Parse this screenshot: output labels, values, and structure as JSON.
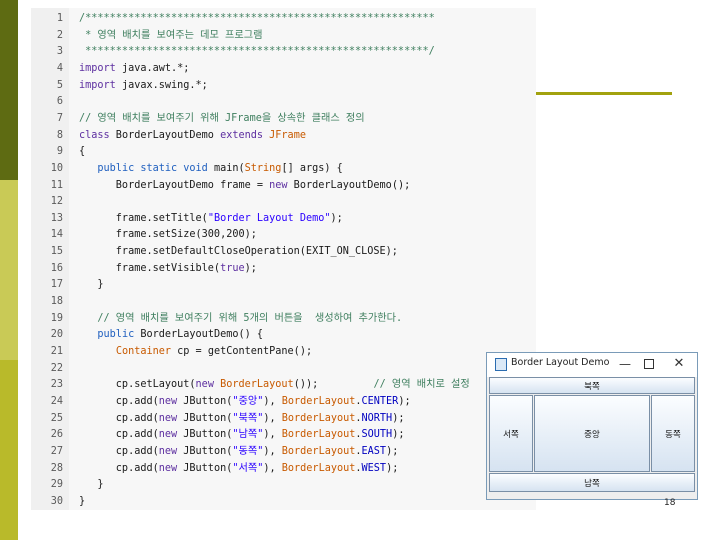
{
  "slide": {
    "page_number": "18"
  },
  "code": {
    "lines": [
      [
        {
          "t": "/*********************************************************",
          "c": "comment"
        }
      ],
      [
        {
          "t": " * 영역 배치를 보여주는 데모 프로그램",
          "c": "comment"
        }
      ],
      [
        {
          "t": " ********************************************************/",
          "c": "comment"
        }
      ],
      [
        {
          "t": "import",
          "c": "kw"
        },
        {
          "t": " java.awt.*;",
          "c": ""
        }
      ],
      [
        {
          "t": "import",
          "c": "kw"
        },
        {
          "t": " javax.swing.*;",
          "c": ""
        }
      ],
      [],
      [
        {
          "t": "// 영역 배치를 보여주기 위해 JFrame을 상속한 클래스 정의",
          "c": "comment"
        }
      ],
      [
        {
          "t": "class",
          "c": "kw"
        },
        {
          "t": " BorderLayoutDemo ",
          "c": ""
        },
        {
          "t": "extends",
          "c": "kw"
        },
        {
          "t": " ",
          "c": ""
        },
        {
          "t": "JFrame",
          "c": "type"
        }
      ],
      [
        {
          "t": "{",
          "c": ""
        }
      ],
      [
        {
          "t": "   ",
          "c": ""
        },
        {
          "t": "public static void",
          "c": "kw2"
        },
        {
          "t": " main(",
          "c": ""
        },
        {
          "t": "String",
          "c": "type"
        },
        {
          "t": "[] args) {",
          "c": ""
        }
      ],
      [
        {
          "t": "      BorderLayoutDemo frame = ",
          "c": ""
        },
        {
          "t": "new",
          "c": "kw"
        },
        {
          "t": " BorderLayoutDemo();",
          "c": ""
        }
      ],
      [],
      [
        {
          "t": "      frame.setTitle(",
          "c": ""
        },
        {
          "t": "\"Border Layout Demo\"",
          "c": "str"
        },
        {
          "t": ");",
          "c": ""
        }
      ],
      [
        {
          "t": "      frame.setSize(300,200);",
          "c": ""
        }
      ],
      [
        {
          "t": "      frame.setDefaultCloseOperation(EXIT_ON_CLOSE);",
          "c": ""
        }
      ],
      [
        {
          "t": "      frame.setVisible(",
          "c": ""
        },
        {
          "t": "true",
          "c": "kw"
        },
        {
          "t": ");",
          "c": ""
        }
      ],
      [
        {
          "t": "   }",
          "c": ""
        }
      ],
      [],
      [
        {
          "t": "   // 영역 배치를 보여주기 위해 5개의 버튼을  생성하여 추가한다.",
          "c": "comment"
        }
      ],
      [
        {
          "t": "   ",
          "c": ""
        },
        {
          "t": "public",
          "c": "kw2"
        },
        {
          "t": " BorderLayoutDemo() {",
          "c": ""
        }
      ],
      [
        {
          "t": "      ",
          "c": ""
        },
        {
          "t": "Container",
          "c": "type"
        },
        {
          "t": " cp = getContentPane();",
          "c": ""
        }
      ],
      [],
      [
        {
          "t": "      cp.setLayout(",
          "c": ""
        },
        {
          "t": "new",
          "c": "kw"
        },
        {
          "t": " ",
          "c": ""
        },
        {
          "t": "BorderLayout",
          "c": "type"
        },
        {
          "t": "());         ",
          "c": ""
        },
        {
          "t": "// 영역 배치로 설정",
          "c": "comment"
        }
      ],
      [
        {
          "t": "      cp.add(",
          "c": ""
        },
        {
          "t": "new",
          "c": "kw"
        },
        {
          "t": " JButton(",
          "c": ""
        },
        {
          "t": "\"중앙\"",
          "c": "str"
        },
        {
          "t": "), ",
          "c": ""
        },
        {
          "t": "BorderLayout",
          "c": "type"
        },
        {
          "t": ".",
          "c": ""
        },
        {
          "t": "CENTER",
          "c": "const"
        },
        {
          "t": ");",
          "c": ""
        }
      ],
      [
        {
          "t": "      cp.add(",
          "c": ""
        },
        {
          "t": "new",
          "c": "kw"
        },
        {
          "t": " JButton(",
          "c": ""
        },
        {
          "t": "\"북쪽\"",
          "c": "str"
        },
        {
          "t": "), ",
          "c": ""
        },
        {
          "t": "BorderLayout",
          "c": "type"
        },
        {
          "t": ".",
          "c": ""
        },
        {
          "t": "NORTH",
          "c": "const"
        },
        {
          "t": ");",
          "c": ""
        }
      ],
      [
        {
          "t": "      cp.add(",
          "c": ""
        },
        {
          "t": "new",
          "c": "kw"
        },
        {
          "t": " JButton(",
          "c": ""
        },
        {
          "t": "\"남쪽\"",
          "c": "str"
        },
        {
          "t": "), ",
          "c": ""
        },
        {
          "t": "BorderLayout",
          "c": "type"
        },
        {
          "t": ".",
          "c": ""
        },
        {
          "t": "SOUTH",
          "c": "const"
        },
        {
          "t": ");",
          "c": ""
        }
      ],
      [
        {
          "t": "      cp.add(",
          "c": ""
        },
        {
          "t": "new",
          "c": "kw"
        },
        {
          "t": " JButton(",
          "c": ""
        },
        {
          "t": "\"동쪽\"",
          "c": "str"
        },
        {
          "t": "), ",
          "c": ""
        },
        {
          "t": "BorderLayout",
          "c": "type"
        },
        {
          "t": ".",
          "c": ""
        },
        {
          "t": "EAST",
          "c": "const"
        },
        {
          "t": ");",
          "c": ""
        }
      ],
      [
        {
          "t": "      cp.add(",
          "c": ""
        },
        {
          "t": "new",
          "c": "kw"
        },
        {
          "t": " JButton(",
          "c": ""
        },
        {
          "t": "\"서쪽\"",
          "c": "str"
        },
        {
          "t": "), ",
          "c": ""
        },
        {
          "t": "BorderLayout",
          "c": "type"
        },
        {
          "t": ".",
          "c": ""
        },
        {
          "t": "WEST",
          "c": "const"
        },
        {
          "t": ");",
          "c": ""
        }
      ],
      [
        {
          "t": "   }",
          "c": ""
        }
      ],
      [
        {
          "t": "}",
          "c": ""
        }
      ]
    ]
  },
  "window": {
    "title": "Border Layout Demo",
    "minimize_glyph": "—",
    "close_glyph": "✕",
    "buttons": {
      "north": "북쪽",
      "west": "서쪽",
      "center": "중앙",
      "east": "동쪽",
      "south": "남쪽"
    }
  },
  "colors": {
    "stripe_dark": "#5e6b12",
    "stripe_light": "#c9ca56",
    "accent": "#a2a20e",
    "comment": "#3f7f5f",
    "keyword": "#5d2fa0",
    "string": "#2a00ff"
  }
}
